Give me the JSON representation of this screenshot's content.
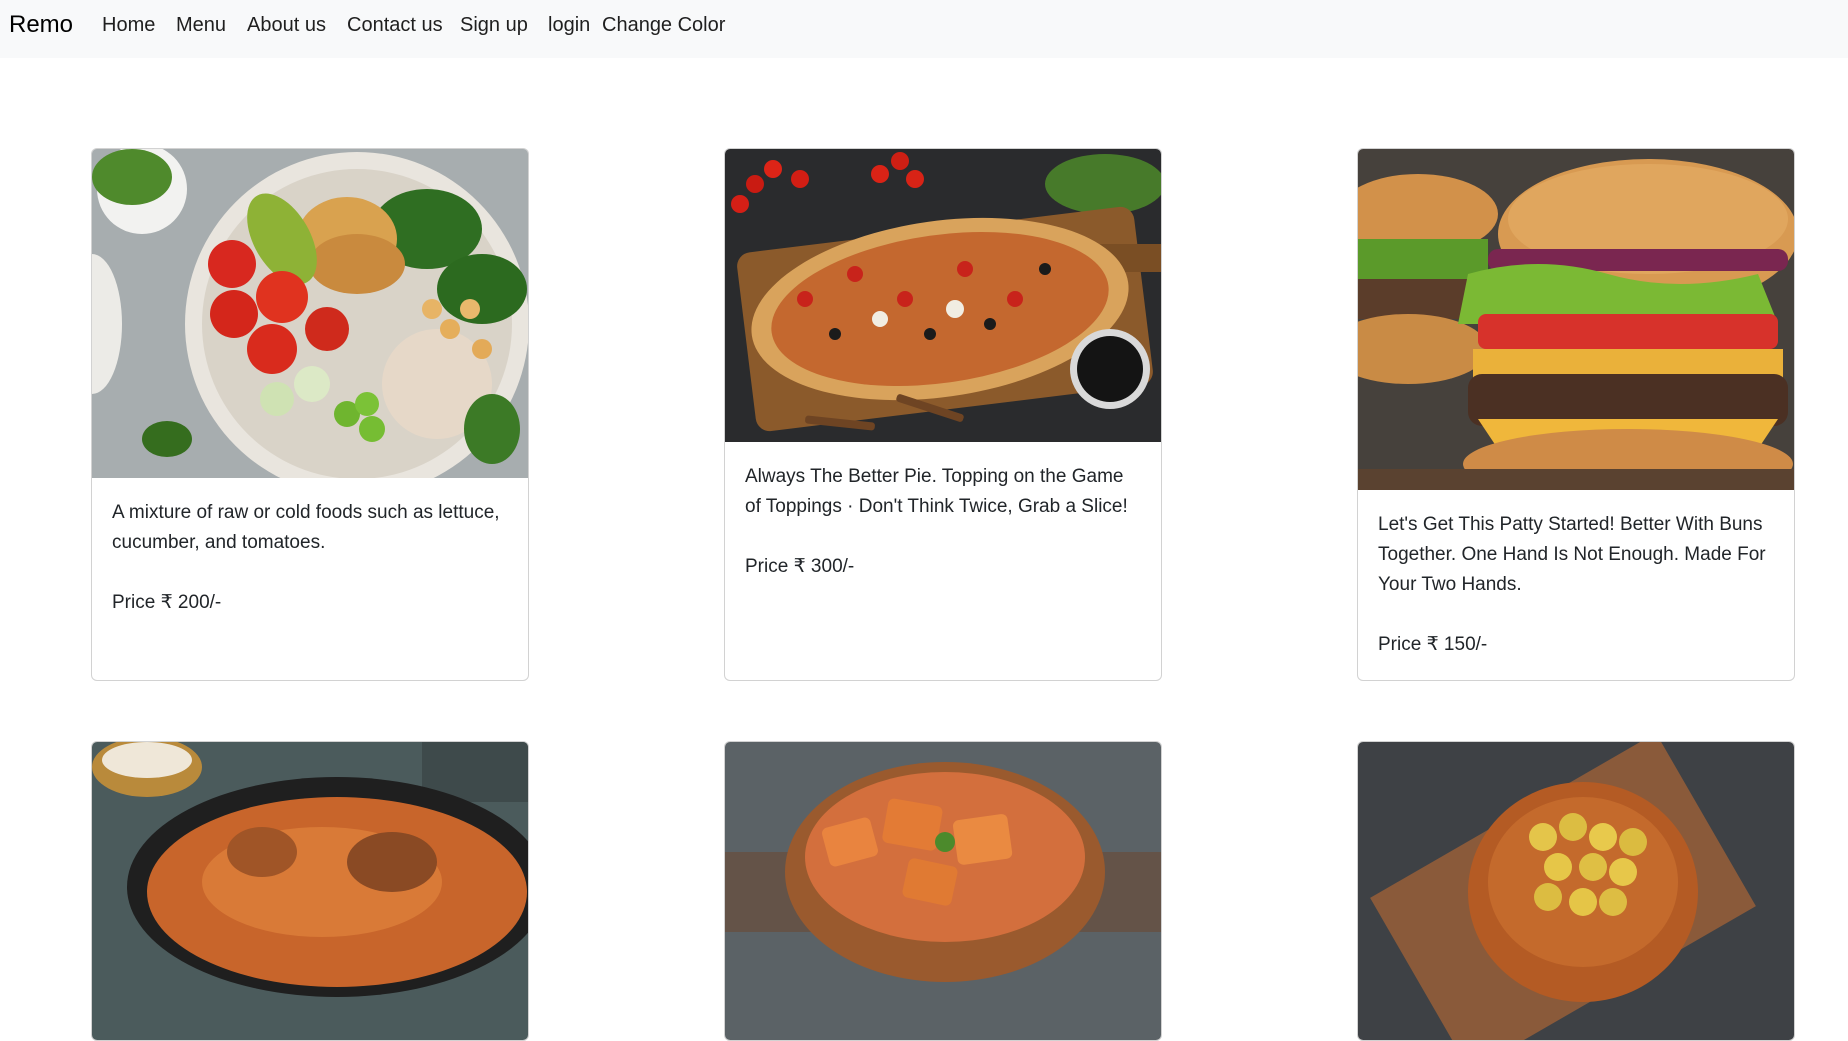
{
  "navbar": {
    "brand": "Remo",
    "links": [
      "Home",
      "Menu",
      "About us",
      "Contact us",
      "Sign up",
      "login",
      "Change Color"
    ]
  },
  "cards": [
    {
      "image": "salad-bowl-image",
      "description": "A mixture of raw or cold foods such as lettuce, cucumber, and tomatoes.",
      "price": "Price ₹ 200/-"
    },
    {
      "image": "pizza-board-image",
      "description": "Always The Better Pie. Topping on the Game of Toppings · Don't Think Twice, Grab a Slice!",
      "price": "Price ₹ 300/-"
    },
    {
      "image": "burger-image",
      "description": "Let's Get This Patty Started! Better With Buns Together. One Hand Is Not Enough. Made For Your Two Hands.",
      "price": "Price ₹ 150/-"
    },
    {
      "image": "biryani-image"
    },
    {
      "image": "paneer-curry-image"
    },
    {
      "image": "potato-curry-image"
    }
  ],
  "colors": {
    "navbar_bg": "#f8f9fa",
    "text": "#212529",
    "card_border": "rgba(0,0,0,0.175)"
  }
}
